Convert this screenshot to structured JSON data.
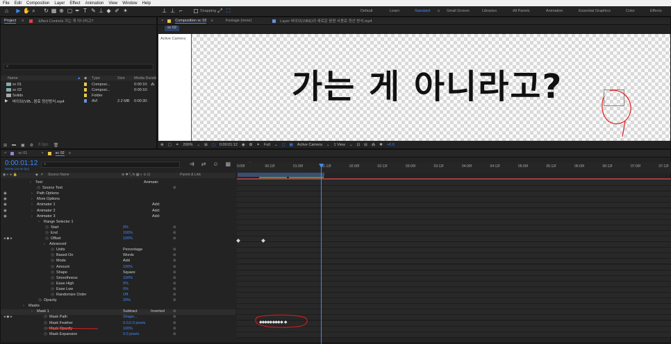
{
  "menu": [
    "File",
    "Edit",
    "Composition",
    "Layer",
    "Effect",
    "Animation",
    "View",
    "Window",
    "Help"
  ],
  "toolbar": {
    "snapping": "Snapping",
    "workspaces": [
      "Default",
      "Learn",
      "Standard",
      "Small Screen",
      "Libraries",
      "All Panels",
      "Animation",
      "Essential Graphics",
      "Color",
      "Effects"
    ]
  },
  "project": {
    "tab_project": "Project",
    "tab_effects": "Effect Controls 가는 게 아니라고?",
    "search_placeholder": "⌕",
    "cols": [
      "Name",
      "Type",
      "Size",
      "Media Duration"
    ],
    "items": [
      {
        "name": "sc 01",
        "type": "Composi...",
        "size": "",
        "duration": "0:00:10:",
        "color": "#e6c84a"
      },
      {
        "name": "sc 02",
        "type": "Composi...",
        "size": "",
        "duration": "0:00:10:",
        "color": "#e6c84a"
      },
      {
        "name": "Solids",
        "type": "Folder",
        "size": "",
        "duration": "",
        "color": "#e6c84a"
      },
      {
        "name": "바이브(VIB...음료 정산방식.mp4",
        "type": "AVI",
        "size": "2.2 MB",
        "duration": "0:00:30:",
        "color": "#6b8fd6"
      }
    ],
    "bpc": "8 bpc"
  },
  "viewer": {
    "tab_comp": "Composition sc 02",
    "tab_footage": "Footage (none)",
    "tab_layer": "Layer 바이브(VIBE)의 새로운 음원 사용료 정산 방식.mp4",
    "sub_tab": "sc 02",
    "active_camera": "Active Camera",
    "overlay_text": "가는 게 아니라고?",
    "zoom": "200%",
    "timecode": "0:00:01:12",
    "resolution": "Full",
    "camera": "Active Camera",
    "views": "1 View",
    "exposure": "+0.0"
  },
  "timeline": {
    "tabs": [
      "sc 01",
      "sc 02"
    ],
    "timecode": "0:00:01:12",
    "frame_info": "00036 (24.00 fps)",
    "search_placeholder": "⌕",
    "col_source": "Source Name",
    "col_parent": "Parent & Link",
    "ruler": [
      "0:00f",
      "00:12f",
      "01:00f",
      "01:12f",
      "02:00f",
      "02:12f",
      "03:00f",
      "03:12f",
      "04:00f",
      "04:12f",
      "05:00f",
      "05:12f",
      "06:00f",
      "06:12f",
      "07:00f",
      "07:12f"
    ],
    "rows": [
      {
        "indent": 50,
        "label": "Text",
        "value": "",
        "extra": "Animate:"
      },
      {
        "indent": 60,
        "label": "Source Text",
        "value": "",
        "extra": ""
      },
      {
        "indent": 52,
        "label": "Path Options",
        "value": "",
        "extra": ""
      },
      {
        "indent": 52,
        "label": "More Options",
        "value": "",
        "extra": ""
      },
      {
        "indent": 52,
        "label": "Animator 1",
        "value": "",
        "extra": "Add:"
      },
      {
        "indent": 52,
        "label": "Animator 2",
        "value": "",
        "extra": "Add:"
      },
      {
        "indent": 52,
        "label": "Animator 3",
        "value": "",
        "extra": "Add:"
      },
      {
        "indent": 62,
        "label": "Range Selector 1",
        "value": "",
        "extra": ""
      },
      {
        "indent": 72,
        "label": "Start",
        "value": "0%",
        "extra": ""
      },
      {
        "indent": 72,
        "label": "End",
        "value": "100%",
        "extra": ""
      },
      {
        "indent": 72,
        "label": "Offset",
        "value": "100%",
        "extra": ""
      },
      {
        "indent": 70,
        "label": "Advanced",
        "value": "",
        "extra": ""
      },
      {
        "indent": 80,
        "label": "Units",
        "value": "Percentage",
        "extra": ""
      },
      {
        "indent": 80,
        "label": "Based On",
        "value": "Words",
        "extra": ""
      },
      {
        "indent": 80,
        "label": "Mode",
        "value": "Add",
        "extra": ""
      },
      {
        "indent": 80,
        "label": "Amount",
        "value": "100%",
        "extra": ""
      },
      {
        "indent": 80,
        "label": "Shape",
        "value": "Square",
        "extra": ""
      },
      {
        "indent": 80,
        "label": "Smoothness",
        "value": "100%",
        "extra": ""
      },
      {
        "indent": 80,
        "label": "Ease High",
        "value": "0%",
        "extra": ""
      },
      {
        "indent": 80,
        "label": "Ease Low",
        "value": "0%",
        "extra": ""
      },
      {
        "indent": 80,
        "label": "Randomize Order",
        "value": "Off",
        "extra": ""
      },
      {
        "indent": 62,
        "label": "Opacity",
        "value": "20%",
        "extra": ""
      },
      {
        "indent": 40,
        "label": "Masks",
        "value": "",
        "extra": ""
      },
      {
        "indent": 52,
        "label": "Mask 1",
        "value": "Subtract",
        "extra": "Inverted"
      },
      {
        "indent": 70,
        "label": "Mask Path",
        "value": "Shape...",
        "extra": ""
      },
      {
        "indent": 70,
        "label": "Mask Feather",
        "value": "0.0,0.0 pixels",
        "extra": ""
      },
      {
        "indent": 70,
        "label": "Mask Opacity",
        "value": "100%",
        "extra": ""
      },
      {
        "indent": 70,
        "label": "Mask Expansion",
        "value": "0.0 pixels",
        "extra": ""
      }
    ]
  }
}
